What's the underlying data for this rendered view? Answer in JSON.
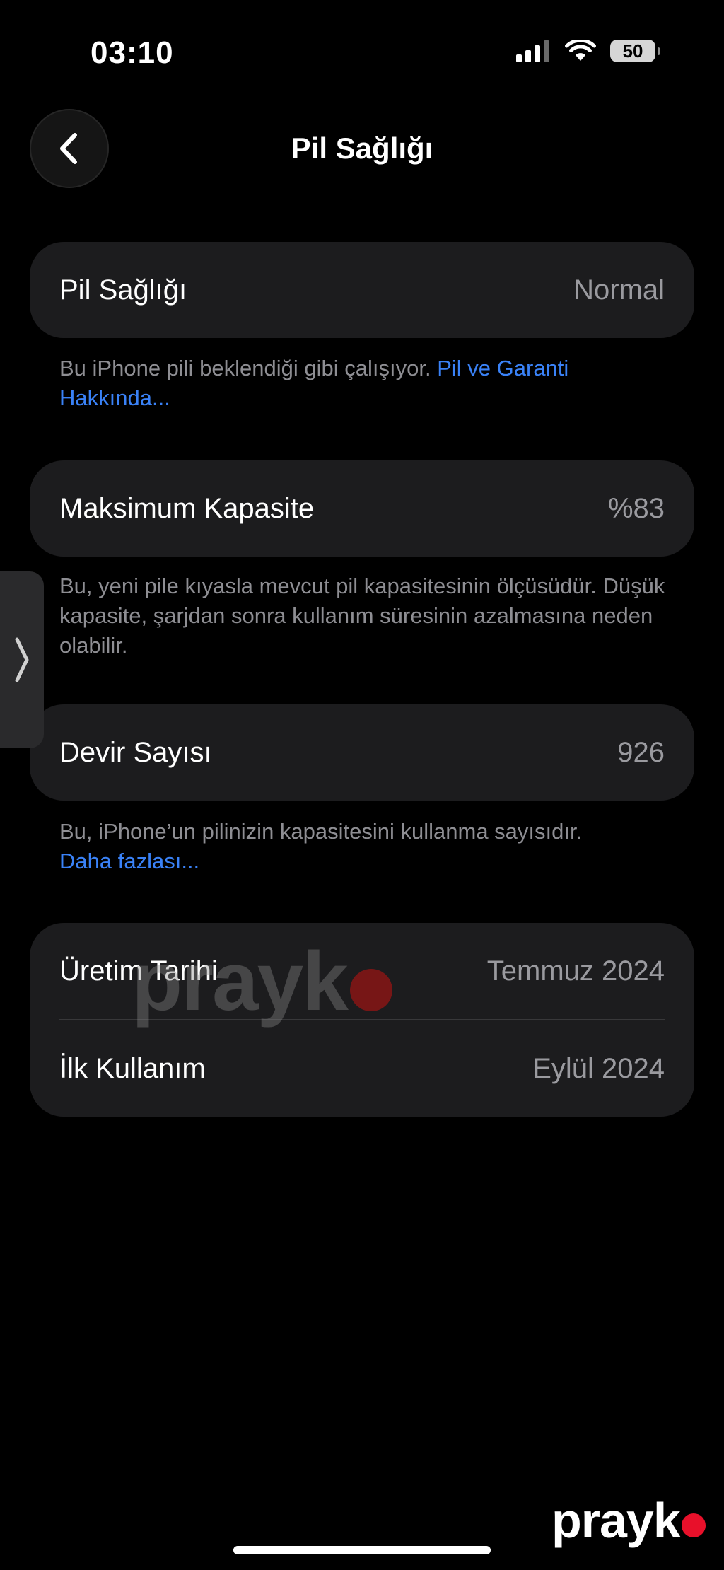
{
  "status_bar": {
    "time": "03:10",
    "battery": "50",
    "icons": [
      "cellular-signal-icon",
      "wifi-icon",
      "battery-icon"
    ]
  },
  "nav": {
    "back_icon": "chevron-left-icon",
    "title": "Pil Sağlığı"
  },
  "battery_health": {
    "label": "Pil Sağlığı",
    "value": "Normal",
    "footnote_text": "Bu iPhone pili beklendiği gibi çalışıyor. ",
    "footnote_link": "Pil ve Garanti Hakkında..."
  },
  "max_capacity": {
    "label": "Maksimum Kapasite",
    "value": "%83",
    "footnote_text": "Bu, yeni pile kıyasla mevcut pil kapasitesinin ölçüsüdür. Düşük kapasite, şarjdan sonra kullanım süresinin azalmasına neden olabilir."
  },
  "cycle_count": {
    "label": "Devir Sayısı",
    "value": "926",
    "footnote_text": "Bu, iPhone’un pilinizin kapasitesini kullanma sayısıdır. ",
    "footnote_link": "Daha fazlası..."
  },
  "dates": {
    "manufacture_label": "Üretim Tarihi",
    "manufacture_value": "Temmuz 2024",
    "first_use_label": "İlk Kullanım",
    "first_use_value": "Eylül 2024"
  },
  "watermark": {
    "text": "prayk"
  },
  "colors": {
    "background": "#000000",
    "card": "#1c1c1e",
    "secondary_text": "#8e8e93",
    "link": "#3a82f7",
    "watermark_dot": "#e8102a"
  }
}
